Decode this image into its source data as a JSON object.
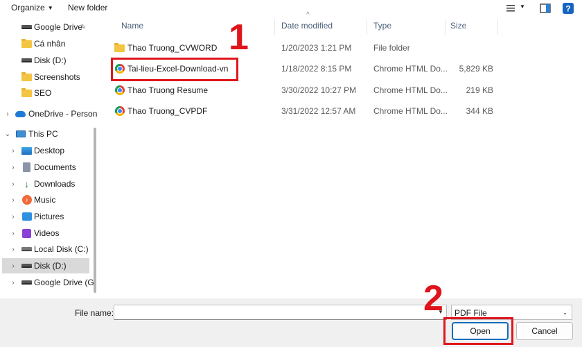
{
  "toolbar": {
    "organize_label": "Organize",
    "new_folder_label": "New folder",
    "icons": [
      "view-list-icon",
      "preview-pane-icon",
      "help-icon"
    ]
  },
  "nav": {
    "items": [
      {
        "label": "Google Drive",
        "icon": "drive-icon",
        "pinned": true
      },
      {
        "label": "Cá nhân",
        "icon": "folder-icon"
      },
      {
        "label": "Disk (D:)",
        "icon": "drive-icon"
      },
      {
        "label": "Screenshots",
        "icon": "folder-icon"
      },
      {
        "label": "SEO",
        "icon": "folder-icon"
      },
      {
        "label": "OneDrive - Person",
        "icon": "cloud-icon"
      },
      {
        "label": "This PC",
        "icon": "pc-icon"
      },
      {
        "label": "Desktop",
        "icon": "desktop-icon"
      },
      {
        "label": "Documents",
        "icon": "documents-icon"
      },
      {
        "label": "Downloads",
        "icon": "downloads-icon"
      },
      {
        "label": "Music",
        "icon": "music-icon"
      },
      {
        "label": "Pictures",
        "icon": "pictures-icon"
      },
      {
        "label": "Videos",
        "icon": "videos-icon"
      },
      {
        "label": "Local Disk (C:)",
        "icon": "local-disk-icon"
      },
      {
        "label": "Disk (D:)",
        "icon": "drive-icon",
        "selected": true
      },
      {
        "label": "Google Drive (G",
        "icon": "drive-icon"
      }
    ]
  },
  "columns": {
    "name": "Name",
    "date": "Date modified",
    "type": "Type",
    "size": "Size"
  },
  "files": [
    {
      "name": "Thao Truong_CVWORD",
      "date": "1/20/2023 1:21 PM",
      "type": "File folder",
      "size": "",
      "icon": "folder-icon"
    },
    {
      "name": "Tai-lieu-Excel-Download-vn",
      "date": "1/18/2022 8:15 PM",
      "type": "Chrome HTML Do...",
      "size": "5,829 KB",
      "icon": "chrome-icon"
    },
    {
      "name": "Thao Truong Resume",
      "date": "3/30/2022 10:27 PM",
      "type": "Chrome HTML Do...",
      "size": "219 KB",
      "icon": "chrome-icon"
    },
    {
      "name": "Thao Truong_CVPDF",
      "date": "3/31/2022 12:57 AM",
      "type": "Chrome HTML Do...",
      "size": "344 KB",
      "icon": "chrome-icon"
    }
  ],
  "bottom": {
    "file_name_label": "File name:",
    "file_name_value": "",
    "file_type_value": "PDF File",
    "open_label": "Open",
    "cancel_label": "Cancel"
  },
  "annotations": {
    "step1": "1",
    "step2": "2",
    "color": "#e0151c"
  }
}
